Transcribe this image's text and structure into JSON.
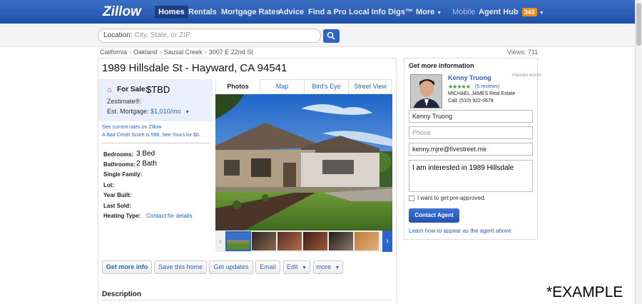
{
  "nav": {
    "logo": "Zillow",
    "items": [
      "Homes",
      "Rentals",
      "Mortgage Rates",
      "Advice",
      "Find a Pro",
      "Local Info",
      "Digs™",
      "More"
    ],
    "mobile": "Mobile",
    "agent_hub": "Agent Hub",
    "agent_hub_count": "343"
  },
  "search": {
    "label": "Location:",
    "placeholder": "City, State, or ZIP"
  },
  "breadcrumb": [
    "California",
    "Oakland",
    "Sausal Creek",
    "3007 E 22nd St"
  ],
  "views": "Views: 711",
  "listing": {
    "address": "1989 Hillsdale St - Hayward, CA 94541",
    "for_sale_label": "For Sale:",
    "price": "$TBD",
    "zestimate_label": "Zestimate®:",
    "mortgage_label": "Est. Mortgage:",
    "mortgage_value": "$1,010/mo",
    "rates_link": "See current rates on Zillow",
    "credit_link": "A Bad Credit Score is 598, See Yours for $0.",
    "facts": {
      "bedrooms_label": "Bedrooms:",
      "bedrooms": "3 Bed",
      "bathrooms_label": "Bathrooms:",
      "bathrooms": "2 Bath",
      "type_label": "Single Family:",
      "lot_label": "Lot:",
      "year_label": "Year Built:",
      "sold_label": "Last Sold:",
      "heating_label": "Heating Type:",
      "heating_link": "Contact for details"
    }
  },
  "media_tabs": [
    "Photos",
    "Map",
    "Bird's Eye",
    "Street View"
  ],
  "actions": [
    "Get more info",
    "Save this home",
    "Get updates",
    "Email",
    "Edit",
    "more"
  ],
  "description_heading": "Description",
  "contact": {
    "heading": "Get more information",
    "agent_name": "Kenny Truong",
    "premier": "PREMIER AGENT",
    "stars": "★★★★★",
    "reviews": "(5 reviews)",
    "brokerage": "MICHAEL JAMES Real Estate",
    "phone": "Call: (510) 922-0678",
    "name_value": "Kenny Truong",
    "phone_placeholder": "Phone",
    "email_value": "kenny.mjre@fivestreet.me",
    "message": "I am interested in 1989 Hillsdale",
    "preapproved_label": "I want to get pre-approved.",
    "button": "Contact Agent",
    "learn_link": "Learn how to appear as the agent above"
  },
  "watermark": "*EXAMPLE",
  "colors": {
    "nav": "#2a5cb8",
    "link": "#2f62c2",
    "button": "#2d63c8",
    "price_icon": "#dd2222"
  }
}
